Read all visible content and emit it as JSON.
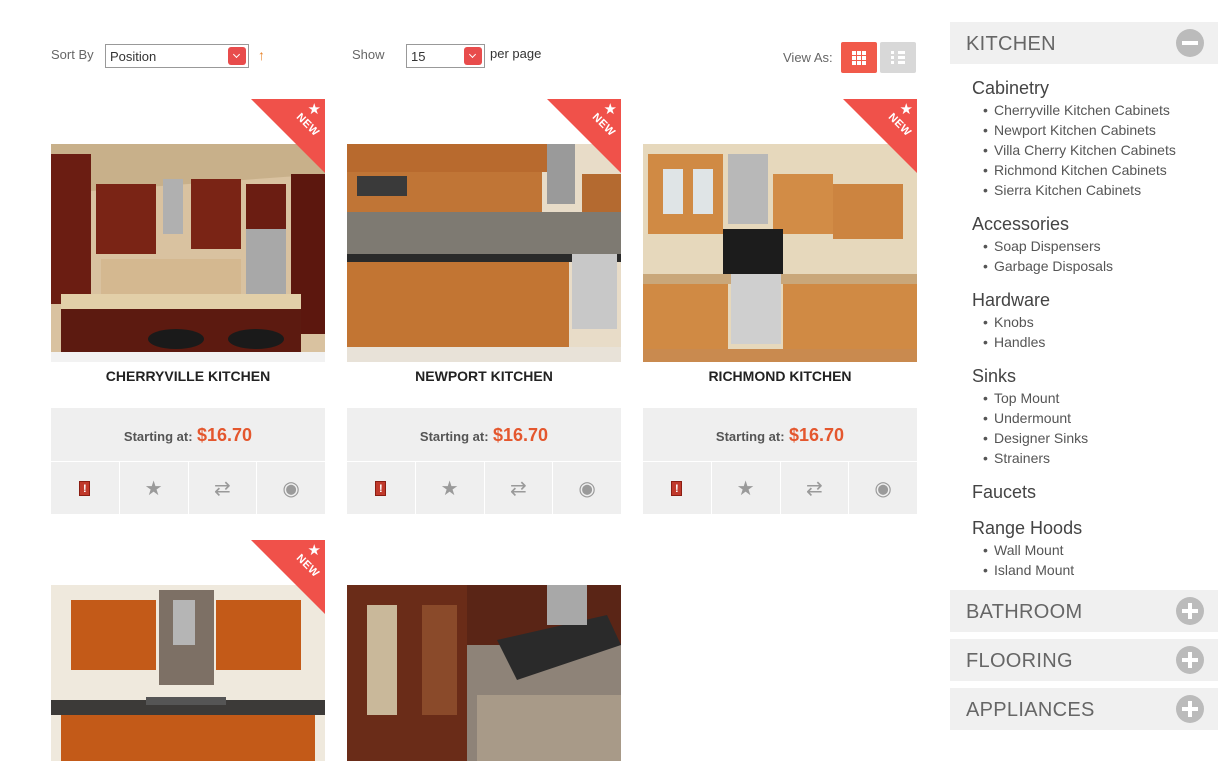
{
  "toolbar": {
    "sort_by_label": "Sort By",
    "sort_value": "Position",
    "show_label": "Show",
    "show_value": "15",
    "per_page_label": "per page",
    "view_as_label": "View As:"
  },
  "products": [
    {
      "title": "CHERRYVILLE KITCHEN",
      "badge": "NEW",
      "price_label": "Starting at:",
      "price": "$16.70"
    },
    {
      "title": "NEWPORT KITCHEN",
      "badge": "NEW",
      "price_label": "Starting at:",
      "price": "$16.70"
    },
    {
      "title": "RICHMOND KITCHEN",
      "badge": "NEW",
      "price_label": "Starting at:",
      "price": "$16.70"
    },
    {
      "badge": "NEW"
    }
  ],
  "sidebar": {
    "sections": [
      {
        "label": "KITCHEN",
        "expanded": true
      },
      {
        "label": "BATHROOM",
        "expanded": false
      },
      {
        "label": "FLOORING",
        "expanded": false
      },
      {
        "label": "APPLIANCES",
        "expanded": false
      }
    ],
    "kitchen_categories": [
      {
        "title": "Cabinetry",
        "items": [
          "Cherryville Kitchen Cabinets",
          "Newport Kitchen Cabinets",
          "Villa Cherry Kitchen Cabinets",
          "Richmond Kitchen Cabinets",
          "Sierra Kitchen Cabinets"
        ]
      },
      {
        "title": "Accessories",
        "items": [
          "Soap Dispensers",
          "Garbage Disposals"
        ]
      },
      {
        "title": "Hardware",
        "items": [
          "Knobs",
          "Handles"
        ]
      },
      {
        "title": "Sinks",
        "items": [
          "Top Mount",
          "Undermount",
          "Designer Sinks",
          "Strainers"
        ]
      },
      {
        "title": "Faucets",
        "items": []
      },
      {
        "title": "Range Hoods",
        "items": [
          "Wall Mount",
          "Island Mount"
        ]
      }
    ]
  },
  "colors": {
    "accent": "#f0514a",
    "price": "#e4572e",
    "panel": "#efefef"
  }
}
